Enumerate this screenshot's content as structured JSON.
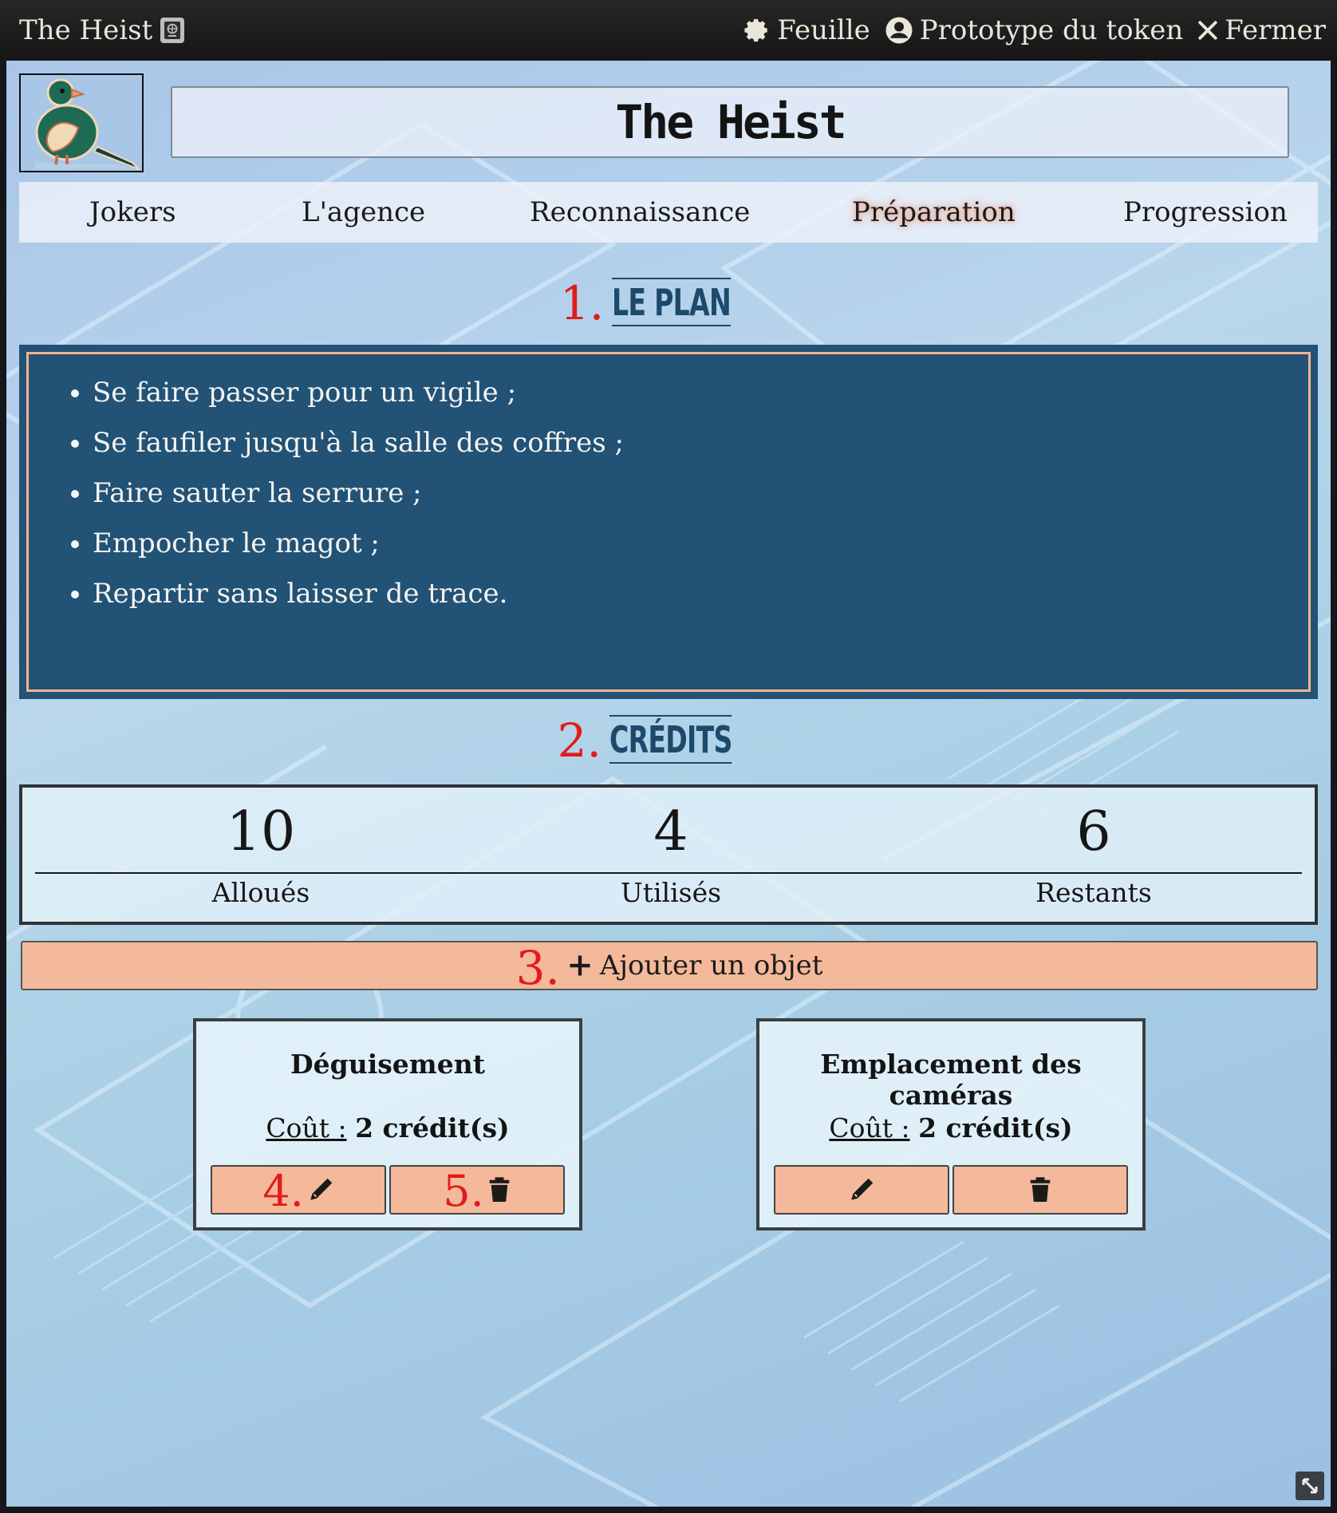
{
  "window": {
    "title": "The Heist",
    "buttons": {
      "sheet": "Feuille",
      "token": "Prototype du token",
      "close": "Fermer"
    }
  },
  "header": {
    "name": "The Heist"
  },
  "tabs": [
    {
      "label": "Jokers"
    },
    {
      "label": "L'agence"
    },
    {
      "label": "Reconnaissance"
    },
    {
      "label": "Préparation",
      "active": true
    },
    {
      "label": "Progression"
    }
  ],
  "plan": {
    "num": "1.",
    "title": "LE PLAN",
    "items": [
      "Se faire passer pour un vigile ;",
      "Se faufiler jusqu'à la salle des coffres ;",
      "Faire sauter la serrure ;",
      "Empocher le magot ;",
      "Repartir sans laisser de trace."
    ]
  },
  "credits": {
    "num": "2.",
    "title": "CRÉDITS",
    "allocated": {
      "value": "10",
      "label": "Alloués"
    },
    "used": {
      "value": "4",
      "label": "Utilisés"
    },
    "remaining": {
      "value": "6",
      "label": "Restants"
    }
  },
  "add_item": {
    "num": "3.",
    "label": "Ajouter un objet"
  },
  "items": [
    {
      "name": "Déguisement",
      "cost_label": "Coût :",
      "cost_value": "2 crédit(s)",
      "edit_num": "4.",
      "delete_num": "5."
    },
    {
      "name": "Emplacement des caméras",
      "cost_label": "Coût :",
      "cost_value": "2 crédit(s)"
    }
  ],
  "colors": {
    "accent": "#f3b99a",
    "plan_bg": "#225275",
    "heading": "#1d4a6b",
    "annotation": "#e31b1b"
  },
  "icons": [
    "passport-icon",
    "gear-icon",
    "user-circle-icon",
    "close-icon",
    "plus-icon",
    "pencil-icon",
    "trash-icon",
    "resize-icon"
  ]
}
